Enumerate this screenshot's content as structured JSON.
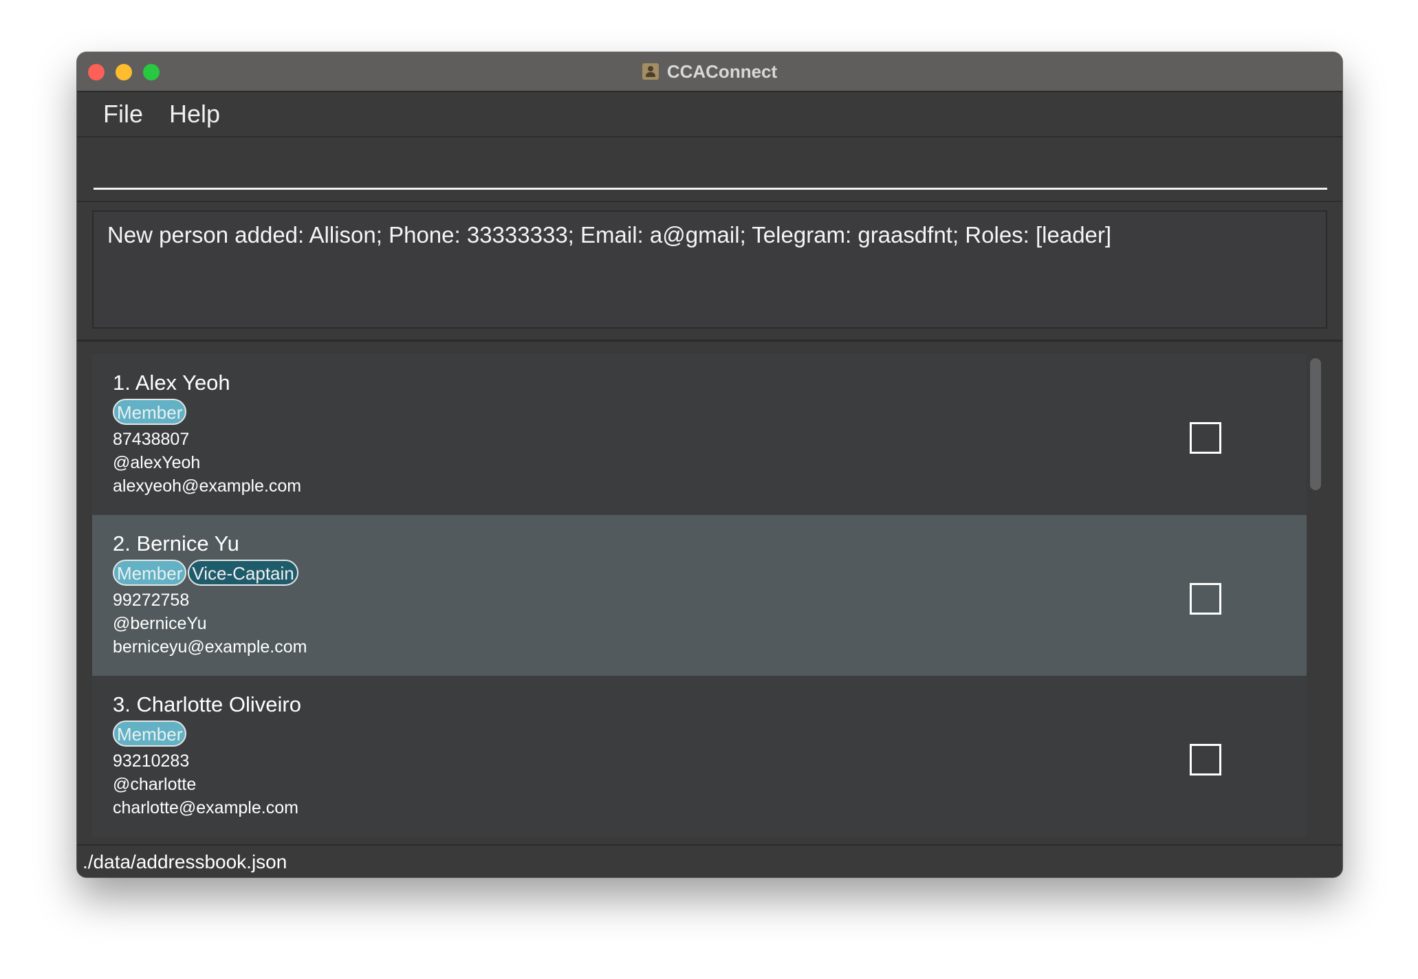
{
  "window": {
    "title": "CCAConnect",
    "app_icon": "contacts-book-icon"
  },
  "menu": {
    "items": [
      "File",
      "Help"
    ]
  },
  "command_box": {
    "value": "",
    "placeholder": ""
  },
  "result_display": {
    "text": "New person added: Allison; Phone: 33333333; Email: a@gmail; Telegram: graasdfnt; Roles: [leader]"
  },
  "persons": [
    {
      "name": "1. Alex Yeoh",
      "tags": [
        {
          "label": "Member",
          "color": "#63b1c4"
        }
      ],
      "phone": "87438807",
      "telegram": "@alexYeoh",
      "email": "alexyeoh@example.com",
      "checked": false,
      "selected": false
    },
    {
      "name": "2. Bernice Yu",
      "tags": [
        {
          "label": "Member",
          "color": "#63b1c4"
        },
        {
          "label": "Vice-Captain",
          "color": "#1f5c6b"
        }
      ],
      "phone": "99272758",
      "telegram": "@berniceYu",
      "email": "berniceyu@example.com",
      "checked": false,
      "selected": true
    },
    {
      "name": "3. Charlotte Oliveiro",
      "tags": [
        {
          "label": "Member",
          "color": "#63b1c4"
        }
      ],
      "phone": "93210283",
      "telegram": "@charlotte",
      "email": "charlotte@example.com",
      "checked": false,
      "selected": false
    }
  ],
  "status_bar": {
    "file_path": "./data/addressbook.json"
  },
  "colors": {
    "window_bg": "#3a3a3a",
    "card_bg": "#3c3d3f",
    "card_selected_bg": "#525a5d",
    "tag_member": "#63b1c4",
    "tag_vice_captain": "#1f5c6b"
  }
}
